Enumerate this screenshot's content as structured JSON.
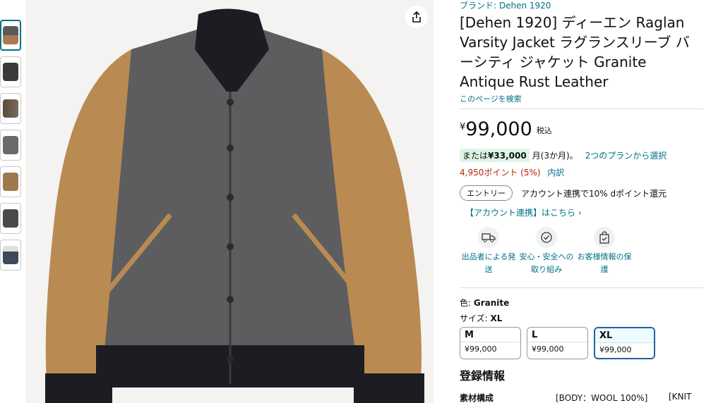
{
  "thumbnails": [
    {
      "color": "#6b5a48"
    },
    {
      "color": "#3a3a3a"
    },
    {
      "color": "#5a4a3a"
    },
    {
      "color": "#6a6a6a"
    },
    {
      "color": "#a07850"
    },
    {
      "color": "#4a4a4a"
    },
    {
      "color": "#3c4a5c"
    }
  ],
  "product": {
    "brand": "ブランド: Dehen 1920",
    "title": "[Dehen 1920] ディーエン Raglan Varsity Jacket ラグランスリーブ バーシティ ジャケット Granite Antique Rust Leather",
    "search_page": "このページを検索",
    "price_symbol": "¥",
    "price": "99,000",
    "tax": "税込",
    "installment_prefix": "または",
    "installment_amount": "¥33,000",
    "installment_suffix": "月(3か月)。",
    "installment_plans": "2つのプランから選択",
    "points": "4,950ポイント (5%)",
    "points_detail": "内訳",
    "entry_label": "エントリー",
    "entry_text": "アカウント連携で10% dポイント還元",
    "account_link": "【アカウント連携】はこちら ›",
    "features": [
      {
        "icon": "truck-icon",
        "label": "出品者による発送"
      },
      {
        "icon": "shield-check-icon",
        "label": "安心・安全への取り組み"
      },
      {
        "icon": "bag-check-icon",
        "label": "お客様情報の保護"
      }
    ],
    "color_label": "色:",
    "color_value": "Granite",
    "size_label": "サイズ:",
    "size_value": "XL",
    "sizes": [
      {
        "name": "M",
        "price": "¥99,000"
      },
      {
        "name": "L",
        "price": "¥99,000"
      },
      {
        "name": "XL",
        "price": "¥99,000"
      }
    ],
    "registration_title": "登録情報",
    "spec_key": "素材構成",
    "spec_val_1": "[BODY：WOOL 100%]",
    "spec_val_2": "[KNIT"
  }
}
